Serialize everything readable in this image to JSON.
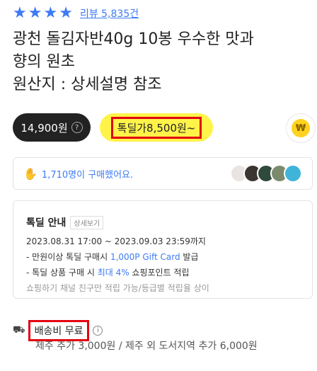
{
  "rating": {
    "stars": 4,
    "star_icon": "star-icon",
    "review_link": "리뷰 5,835건"
  },
  "product": {
    "title_lines": [
      "광천 돌김자반40g 10봉 우수한 맛과",
      "향의 원초",
      "원산지 : 상세설명 참조"
    ]
  },
  "price": {
    "regular": "14,900원",
    "info_icon": "?",
    "deal_label": "톡딜가8,500원~",
    "deal_color": "#fff34a",
    "coin_icon": "₩"
  },
  "buyers": {
    "text": "1,710명이 구매했어요.",
    "icon": "hand-icon",
    "accent": "#3d7bf5"
  },
  "deal_info": {
    "title": "톡딜 안내",
    "detail_button": "상세보기",
    "period": "2023.08.31 17:00 ~ 2023.09.03 23:59까지",
    "line2_prefix": "- 만원이상 톡딜 구매시 ",
    "line2_highlight": "1,000P Gift Card",
    "line2_suffix": " 발급",
    "line3_prefix": "- 톡딜 상품 구매 시 ",
    "line3_highlight": "최대 4%",
    "line3_suffix": " 쇼핑포인트 적립",
    "note": "쇼핑하기 채널 친구만 적립 가능/등급별 적립율 상이"
  },
  "shipping": {
    "label": "배송비 무료",
    "info_icon": "i",
    "note": "제주 추가 3,000원 / 제주 외 도서지역 추가 6,000원"
  }
}
